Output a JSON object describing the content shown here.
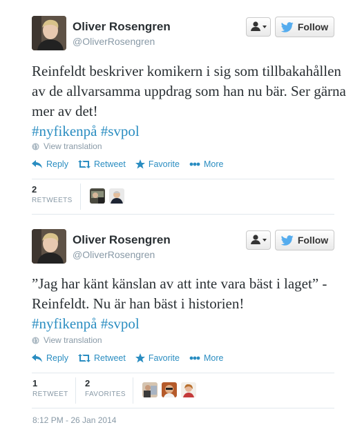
{
  "tweets": [
    {
      "fullname": "Oliver Rosengren",
      "username": "@OliverRosengren",
      "follow_label": "Follow",
      "text": "Reinfeldt beskriver komikern i sig som tillbakahållen av de allvarsamma uppdrag som han nu bär. Ser gärna mer av det!",
      "hashtags": [
        "#nyfikenpå",
        "#svpol"
      ],
      "view_translation": "View translation",
      "actions": {
        "reply": "Reply",
        "retweet": "Retweet",
        "favorite": "Favorite",
        "more": "More"
      },
      "stats": {
        "retweets_count": "2",
        "retweets_label": "RETWEETS"
      }
    },
    {
      "fullname": "Oliver Rosengren",
      "username": "@OliverRosengren",
      "follow_label": "Follow",
      "text": "”Jag har känt känslan av att inte vara bäst i laget” - Reinfeldt. Nu är han bäst i historien!",
      "hashtags": [
        "#nyfikenpå",
        "#svpol"
      ],
      "view_translation": "View translation",
      "actions": {
        "reply": "Reply",
        "retweet": "Retweet",
        "favorite": "Favorite",
        "more": "More"
      },
      "stats": {
        "retweets_count": "1",
        "retweets_label": "RETWEET",
        "favorites_count": "2",
        "favorites_label": "FAVORITES"
      },
      "timestamp": "8:12 PM - 26 Jan 2014"
    }
  ],
  "colors": {
    "link": "#2a8dc1",
    "muted": "#8899a6",
    "text": "#292f33",
    "twitter_blue": "#55acee"
  },
  "icons": [
    "user-dropdown-icon",
    "twitter-bird-icon",
    "globe-icon",
    "reply-icon",
    "retweet-icon",
    "favorite-star-icon",
    "more-dots-icon"
  ]
}
